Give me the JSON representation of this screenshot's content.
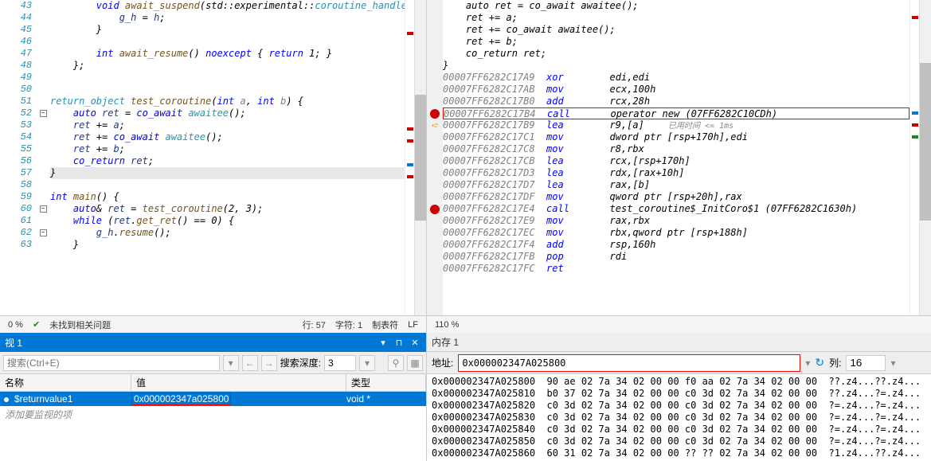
{
  "left_editor": {
    "lines": [
      43,
      44,
      45,
      46,
      47,
      48,
      49,
      50,
      51,
      52,
      53,
      54,
      55,
      56,
      57,
      58,
      59,
      60,
      61,
      62,
      63
    ],
    "code": [
      {
        "indent": 2,
        "tokens": [
          {
            "t": "void ",
            "c": "kw"
          },
          {
            "t": "await_suspend",
            "c": "fn"
          },
          {
            "t": "(std::experimental::",
            "c": ""
          },
          {
            "t": "coroutine_handle",
            "c": "type"
          },
          {
            "t": "<>"
          }
        ]
      },
      {
        "indent": 3,
        "tokens": [
          {
            "t": "g_h",
            "c": "var"
          },
          {
            "t": " = "
          },
          {
            "t": "h",
            "c": "var"
          },
          {
            "t": ";"
          }
        ]
      },
      {
        "indent": 2,
        "tokens": [
          {
            "t": "}"
          }
        ]
      },
      {
        "indent": 0,
        "tokens": []
      },
      {
        "indent": 2,
        "tokens": [
          {
            "t": "int ",
            "c": "kw"
          },
          {
            "t": "await_resume",
            "c": "fn"
          },
          {
            "t": "() "
          },
          {
            "t": "noexcept",
            "c": "kw"
          },
          {
            "t": " { "
          },
          {
            "t": "return",
            "c": "kw"
          },
          {
            "t": " 1; }"
          }
        ]
      },
      {
        "indent": 1,
        "tokens": [
          {
            "t": "};"
          }
        ]
      },
      {
        "indent": 0,
        "tokens": []
      },
      {
        "indent": 0,
        "tokens": []
      },
      {
        "indent": 0,
        "tokens": [
          {
            "t": "return_object",
            "c": "type"
          },
          {
            "t": " "
          },
          {
            "t": "test_coroutine",
            "c": "fn"
          },
          {
            "t": "("
          },
          {
            "t": "int",
            "c": "kw"
          },
          {
            "t": " "
          },
          {
            "t": "a",
            "c": "gray"
          },
          {
            "t": ", "
          },
          {
            "t": "int",
            "c": "kw"
          },
          {
            "t": " "
          },
          {
            "t": "b",
            "c": "gray"
          },
          {
            "t": ") {"
          }
        ]
      },
      {
        "indent": 1,
        "tokens": [
          {
            "t": "auto",
            "c": "kw"
          },
          {
            "t": " "
          },
          {
            "t": "ret",
            "c": "var"
          },
          {
            "t": " = "
          },
          {
            "t": "co_await",
            "c": "kw"
          },
          {
            "t": " "
          },
          {
            "t": "awaitee",
            "c": "type"
          },
          {
            "t": "();"
          }
        ]
      },
      {
        "indent": 1,
        "tokens": [
          {
            "t": "ret",
            "c": "var"
          },
          {
            "t": " += "
          },
          {
            "t": "a",
            "c": "var"
          },
          {
            "t": ";"
          }
        ]
      },
      {
        "indent": 1,
        "tokens": [
          {
            "t": "ret",
            "c": "var"
          },
          {
            "t": " += "
          },
          {
            "t": "co_await",
            "c": "kw"
          },
          {
            "t": " "
          },
          {
            "t": "awaitee",
            "c": "type"
          },
          {
            "t": "();"
          }
        ]
      },
      {
        "indent": 1,
        "tokens": [
          {
            "t": "ret",
            "c": "var"
          },
          {
            "t": " += "
          },
          {
            "t": "b",
            "c": "var"
          },
          {
            "t": ";"
          }
        ]
      },
      {
        "indent": 1,
        "tokens": [
          {
            "t": "co_return",
            "c": "kw"
          },
          {
            "t": " "
          },
          {
            "t": "ret",
            "c": "var"
          },
          {
            "t": ";"
          }
        ]
      },
      {
        "indent": 0,
        "tokens": [
          {
            "t": "}"
          }
        ],
        "hl": true
      },
      {
        "indent": 0,
        "tokens": []
      },
      {
        "indent": 0,
        "tokens": [
          {
            "t": "int ",
            "c": "kw"
          },
          {
            "t": "main",
            "c": "fn"
          },
          {
            "t": "() {"
          }
        ]
      },
      {
        "indent": 1,
        "tokens": [
          {
            "t": "auto",
            "c": "kw"
          },
          {
            "t": "& "
          },
          {
            "t": "ret",
            "c": "var"
          },
          {
            "t": " = "
          },
          {
            "t": "test_coroutine",
            "c": "fn"
          },
          {
            "t": "(2, 3);"
          }
        ]
      },
      {
        "indent": 1,
        "tokens": [
          {
            "t": "while",
            "c": "kw"
          },
          {
            "t": " ("
          },
          {
            "t": "ret",
            "c": "var"
          },
          {
            "t": "."
          },
          {
            "t": "get_ret",
            "c": "fn"
          },
          {
            "t": "() == 0) {"
          }
        ]
      },
      {
        "indent": 2,
        "tokens": [
          {
            "t": "g_h",
            "c": "var"
          },
          {
            "t": "."
          },
          {
            "t": "resume",
            "c": "fn"
          },
          {
            "t": "();"
          }
        ]
      },
      {
        "indent": 1,
        "tokens": [
          {
            "t": "}"
          }
        ]
      }
    ],
    "fold": [
      "",
      "",
      "",
      "",
      "",
      "",
      "",
      "",
      "",
      "-",
      "",
      "",
      "",
      "",
      "",
      "",
      "",
      "-",
      "",
      "-",
      "",
      ""
    ],
    "status": {
      "zoom": "0 %",
      "no_issues": "未找到相关问题",
      "line": "行: 57",
      "char": "字符: 1",
      "tabs": "制表符",
      "lf": "LF"
    }
  },
  "right_editor": {
    "src_lines": [
      {
        "tokens": [
          {
            "t": "    auto ret = co_await awaitee();",
            "c": ""
          }
        ]
      },
      {
        "tokens": [
          {
            "t": "    ret += a;",
            "c": ""
          }
        ]
      },
      {
        "tokens": [
          {
            "t": "    ret += co_await awaitee();",
            "c": ""
          }
        ]
      },
      {
        "tokens": [
          {
            "t": "    ret += b;",
            "c": ""
          }
        ]
      },
      {
        "tokens": [
          {
            "t": "    co_return ret;",
            "c": ""
          }
        ]
      },
      {
        "tokens": [
          {
            "t": "}",
            "c": ""
          }
        ]
      }
    ],
    "asm": [
      {
        "addr": "00007FF6282C17A9",
        "mnem": "xor",
        "ops": "edi,edi"
      },
      {
        "addr": "00007FF6282C17AB",
        "mnem": "mov",
        "ops": "ecx,100h"
      },
      {
        "addr": "00007FF6282C17B0",
        "mnem": "add",
        "ops": "rcx,28h"
      },
      {
        "addr": "00007FF6282C17B4",
        "mnem": "call",
        "ops": "operator new (07FF6282C10CDh)",
        "bp": true,
        "hl": true
      },
      {
        "addr": "00007FF6282C17B9",
        "mnem": "lea",
        "ops": "r9,[a]",
        "arrow": true,
        "timing": "已用时间 <= 1ms"
      },
      {
        "addr": "00007FF6282C17C1",
        "mnem": "mov",
        "ops": "dword ptr [rsp+170h],edi"
      },
      {
        "addr": "00007FF6282C17C8",
        "mnem": "mov",
        "ops": "r8,rbx"
      },
      {
        "addr": "00007FF6282C17CB",
        "mnem": "lea",
        "ops": "rcx,[rsp+170h]"
      },
      {
        "addr": "00007FF6282C17D3",
        "mnem": "lea",
        "ops": "rdx,[rax+10h]"
      },
      {
        "addr": "00007FF6282C17D7",
        "mnem": "lea",
        "ops": "rax,[b]"
      },
      {
        "addr": "00007FF6282C17DF",
        "mnem": "mov",
        "ops": "qword ptr [rsp+20h],rax"
      },
      {
        "addr": "00007FF6282C17E4",
        "mnem": "call",
        "ops": "test_coroutine$_InitCoro$1 (07FF6282C1630h)",
        "bp": true
      },
      {
        "addr": "00007FF6282C17E9",
        "mnem": "mov",
        "ops": "rax,rbx"
      },
      {
        "addr": "00007FF6282C17EC",
        "mnem": "mov",
        "ops": "rbx,qword ptr [rsp+188h]"
      },
      {
        "addr": "00007FF6282C17F4",
        "mnem": "add",
        "ops": "rsp,160h"
      },
      {
        "addr": "00007FF6282C17FB",
        "mnem": "pop",
        "ops": "rdi"
      },
      {
        "addr": "00007FF6282C17FC",
        "mnem": "ret",
        "ops": ""
      }
    ],
    "status": {
      "zoom": "110 %"
    }
  },
  "watch": {
    "title": "视 1",
    "search_ph": "搜索(Ctrl+E)",
    "depth_label": "搜索深度:",
    "depth_value": "3",
    "headers": {
      "name": "名称",
      "value": "值",
      "type": "类型"
    },
    "rows": [
      {
        "name": "$returnvalue1",
        "value": "0x000002347a025800",
        "type": "void *"
      }
    ],
    "add_item": "添加要监视的项"
  },
  "memory": {
    "title": "内存 1",
    "addr_label": "地址:",
    "addr_value": "0x000002347A025800",
    "cols_label": "列:",
    "cols_value": "16",
    "rows": [
      {
        "a": "0x000002347A025800",
        "h": "90 ae 02 7a 34 02 00 00 f0 aa 02 7a 34 02 00 00",
        "t": "??.z4...??.z4..."
      },
      {
        "a": "0x000002347A025810",
        "h": "b0 37 02 7a 34 02 00 00 c0 3d 02 7a 34 02 00 00",
        "t": "??.z4...?=.z4..."
      },
      {
        "a": "0x000002347A025820",
        "h": "c0 3d 02 7a 34 02 00 00 c0 3d 02 7a 34 02 00 00",
        "t": "?=.z4...?=.z4..."
      },
      {
        "a": "0x000002347A025830",
        "h": "c0 3d 02 7a 34 02 00 00 c0 3d 02 7a 34 02 00 00",
        "t": "?=.z4...?=.z4..."
      },
      {
        "a": "0x000002347A025840",
        "h": "c0 3d 02 7a 34 02 00 00 c0 3d 02 7a 34 02 00 00",
        "t": "?=.z4...?=.z4..."
      },
      {
        "a": "0x000002347A025850",
        "h": "c0 3d 02 7a 34 02 00 00 c0 3d 02 7a 34 02 00 00",
        "t": "?=.z4...?=.z4..."
      },
      {
        "a": "0x000002347A025860",
        "h": "60 31 02 7a 34 02 00 00 ?? ?? 02 7a 34 02 00 00",
        "t": "?1.z4...??.z4..."
      }
    ]
  }
}
